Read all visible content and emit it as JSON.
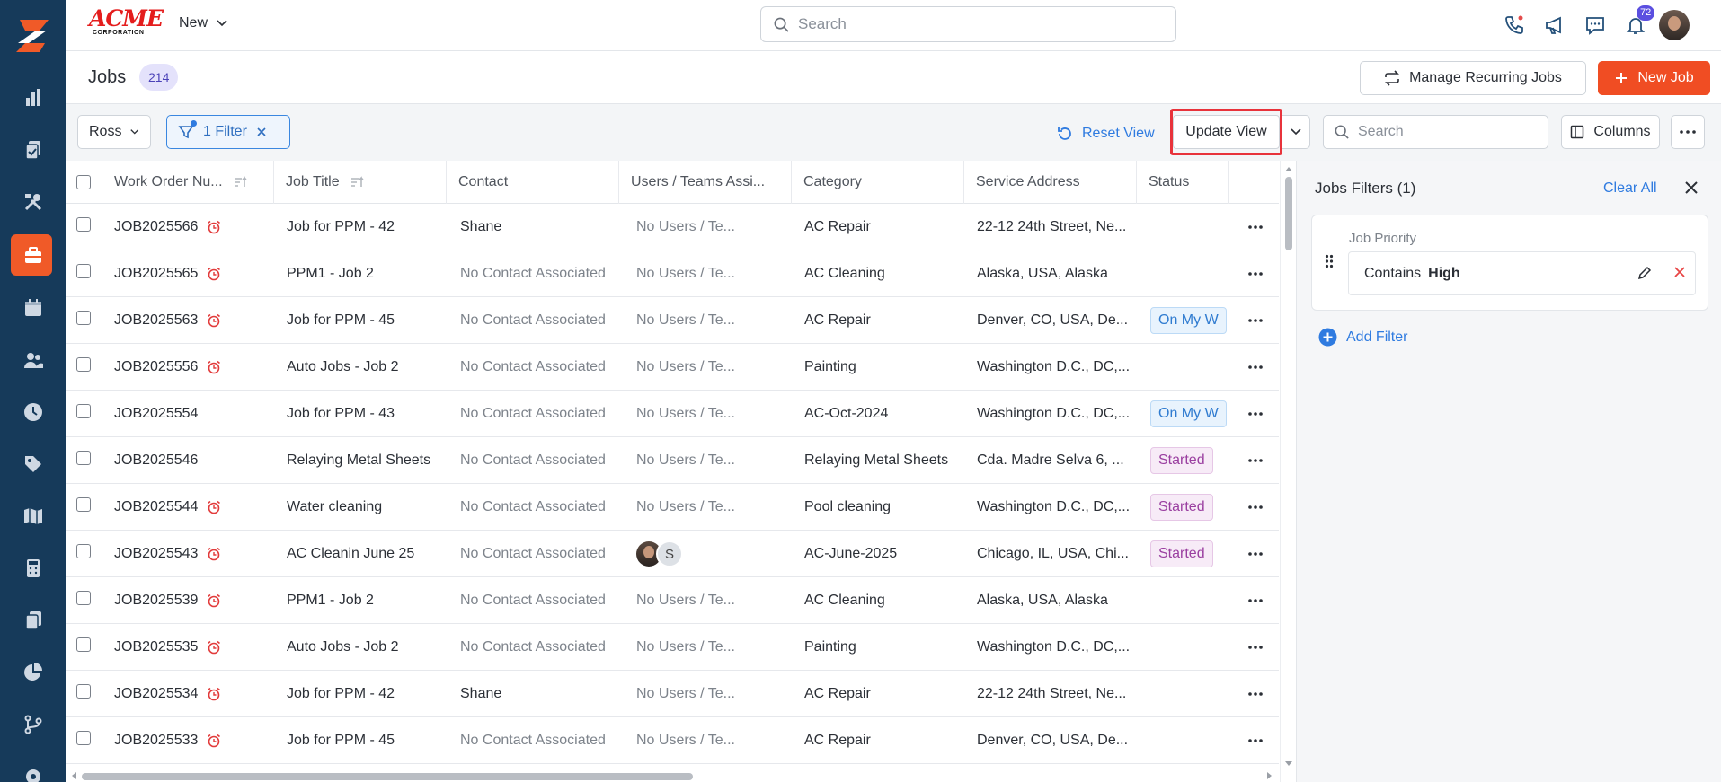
{
  "brand": {
    "name": "ACME",
    "tagline": "CORPORATION"
  },
  "topbar": {
    "new_label": "New",
    "search_placeholder": "Search",
    "notification_count": "72"
  },
  "page": {
    "title": "Jobs",
    "count": "214"
  },
  "header_actions": {
    "recurring_label": "Manage Recurring Jobs",
    "new_job_label": "New Job"
  },
  "toolbar": {
    "view_name": "Ross",
    "filter_label": "1 Filter",
    "reset_label": "Reset View",
    "update_label": "Update View",
    "search_placeholder": "Search",
    "columns_label": "Columns"
  },
  "grid": {
    "columns": [
      "Work Order Nu...",
      "Job Title",
      "Contact",
      "Users / Teams Assi...",
      "Category",
      "Service Address",
      "Status"
    ],
    "rows": [
      {
        "id": "JOB2025566",
        "alarm": true,
        "title": "Job for PPM - 42",
        "contact": "Shane",
        "contact_muted": false,
        "users": "No Users / Te...",
        "category": "AC Repair",
        "address": "22-12 24th Street, Ne...",
        "status": ""
      },
      {
        "id": "JOB2025565",
        "alarm": true,
        "title": "PPM1 - Job 2",
        "contact": "No Contact Associated",
        "contact_muted": true,
        "users": "No Users / Te...",
        "category": "AC Cleaning",
        "address": "Alaska, USA, Alaska",
        "status": ""
      },
      {
        "id": "JOB2025563",
        "alarm": true,
        "title": "Job for PPM - 45",
        "contact": "No Contact Associated",
        "contact_muted": true,
        "users": "No Users / Te...",
        "category": "AC Repair",
        "address": "Denver, CO, USA, De...",
        "status": "On My W"
      },
      {
        "id": "JOB2025556",
        "alarm": true,
        "title": "Auto Jobs - Job 2",
        "contact": "No Contact Associated",
        "contact_muted": true,
        "users": "No Users / Te...",
        "category": "Painting",
        "address": "Washington D.C., DC,...",
        "status": ""
      },
      {
        "id": "JOB2025554",
        "alarm": false,
        "title": "Job for PPM - 43",
        "contact": "No Contact Associated",
        "contact_muted": true,
        "users": "No Users / Te...",
        "category": "AC-Oct-2024",
        "address": "Washington D.C., DC,...",
        "status": "On My W"
      },
      {
        "id": "JOB2025546",
        "alarm": false,
        "title": "Relaying Metal Sheets",
        "contact": "No Contact Associated",
        "contact_muted": true,
        "users": "No Users / Te...",
        "category": "Relaying Metal Sheets",
        "address": "Cda. Madre Selva 6, ...",
        "status": "Started"
      },
      {
        "id": "JOB2025544",
        "alarm": true,
        "title": "Water cleaning",
        "contact": "No Contact Associated",
        "contact_muted": true,
        "users": "No Users / Te...",
        "category": "Pool cleaning",
        "address": "Washington D.C., DC,...",
        "status": "Started"
      },
      {
        "id": "JOB2025543",
        "alarm": true,
        "title": "AC Cleanin June 25",
        "contact": "No Contact Associated",
        "contact_muted": true,
        "users": "",
        "users_avatar_letter": "S",
        "category": "AC-June-2025",
        "address": "Chicago, IL, USA, Chi...",
        "status": "Started"
      },
      {
        "id": "JOB2025539",
        "alarm": true,
        "title": "PPM1 - Job 2",
        "contact": "No Contact Associated",
        "contact_muted": true,
        "users": "No Users / Te...",
        "category": "AC Cleaning",
        "address": "Alaska, USA, Alaska",
        "status": ""
      },
      {
        "id": "JOB2025535",
        "alarm": true,
        "title": "Auto Jobs - Job 2",
        "contact": "No Contact Associated",
        "contact_muted": true,
        "users": "No Users / Te...",
        "category": "Painting",
        "address": "Washington D.C., DC,...",
        "status": ""
      },
      {
        "id": "JOB2025534",
        "alarm": true,
        "title": "Job for PPM - 42",
        "contact": "Shane",
        "contact_muted": false,
        "users": "No Users / Te...",
        "category": "AC Repair",
        "address": "22-12 24th Street, Ne...",
        "status": ""
      },
      {
        "id": "JOB2025533",
        "alarm": true,
        "title": "Job for PPM - 45",
        "contact": "No Contact Associated",
        "contact_muted": true,
        "users": "No Users / Te...",
        "category": "AC Repair",
        "address": "Denver, CO, USA, De...",
        "status": ""
      }
    ]
  },
  "filter_panel": {
    "title": "Jobs Filters (1)",
    "clear_label": "Clear All",
    "field_label": "Job Priority",
    "operator": "Contains",
    "value": "High",
    "add_label": "Add Filter"
  },
  "colors": {
    "accent": "#f04d23",
    "nav": "#163a5a",
    "link": "#2f7be0",
    "highlight_box": "#e8333b"
  }
}
